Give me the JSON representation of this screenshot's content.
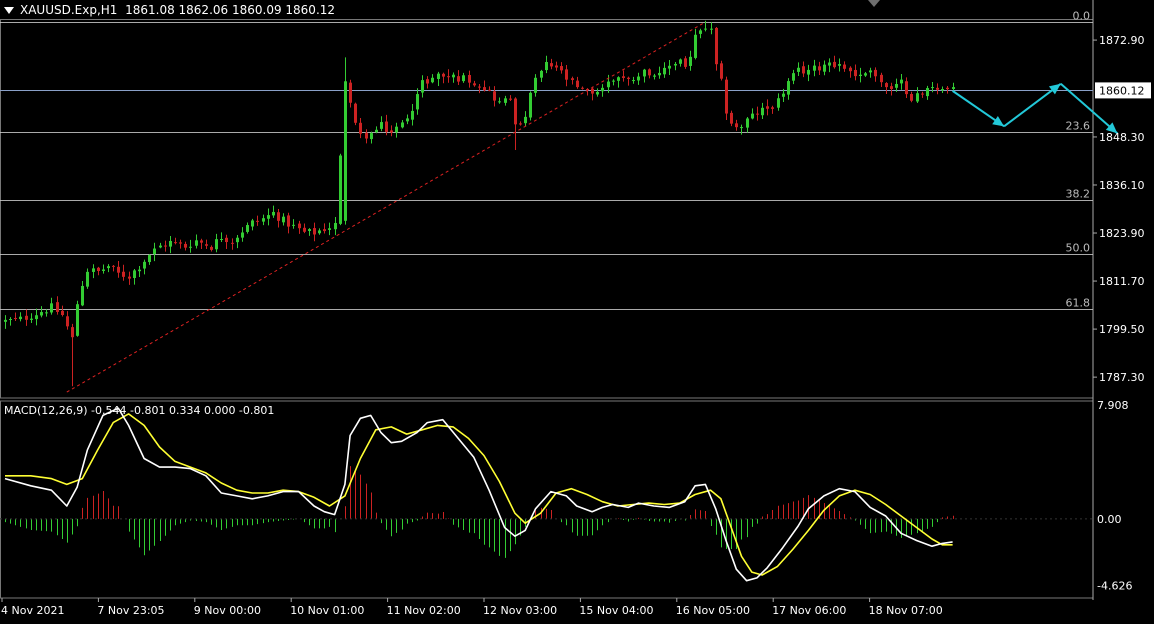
{
  "header": {
    "symbol": "XAUUSD.Exp,H1",
    "ohlc": "1861.08 1862.06 1860.09 1860.12"
  },
  "macd_header": {
    "label": "MACD(12,26,9)",
    "values": "-0.544 -0.801 0.334 0.000 -0.801"
  },
  "colors": {
    "background": "#000000",
    "bull": "#33cc33",
    "bear": "#cc2222",
    "grid": "#c8c8c8",
    "macd_line": "#ffffff",
    "signal_line": "#ffff33",
    "trend": "#dd2222",
    "forecast": "#22c8d8",
    "price_box": "#ffffff"
  },
  "chart_data": [
    {
      "type": "candlestick",
      "title": "XAUUSD.Exp,H1",
      "ylim": [
        1782.0,
        1878.0
      ],
      "price_ticks": [
        "1872.90",
        "1860.12",
        "1848.30",
        "1836.10",
        "1823.90",
        "1811.70",
        "1799.50",
        "1787.30"
      ],
      "time_ticks": [
        "4 Nov 2021",
        "7 Nov 23:05",
        "9 Nov 00:00",
        "10 Nov 01:00",
        "11 Nov 02:00",
        "12 Nov 03:00",
        "15 Nov 04:00",
        "16 Nov 05:00",
        "17 Nov 06:00",
        "18 Nov 07:00"
      ],
      "current_price": "1860.12",
      "fibonacci": [
        {
          "level": "0.0",
          "price": 1877.4
        },
        {
          "level": "23.6",
          "price": 1849.6
        },
        {
          "level": "38.2",
          "price": 1832.4
        },
        {
          "level": "50.0",
          "price": 1818.5
        },
        {
          "level": "61.8",
          "price": 1804.6
        }
      ],
      "close_path": [
        [
          0,
          1801.5
        ],
        [
          3,
          1802
        ],
        [
          6,
          1803.5
        ],
        [
          9,
          1805
        ],
        [
          11,
          1803
        ],
        [
          13,
          1797
        ],
        [
          14,
          1806
        ],
        [
          15,
          1811
        ],
        [
          16,
          1814.5
        ],
        [
          18,
          1814
        ],
        [
          20,
          1815.5
        ],
        [
          22,
          1813.5
        ],
        [
          24,
          1813
        ],
        [
          26,
          1815.5
        ],
        [
          28,
          1818.5
        ],
        [
          30,
          1820.5
        ],
        [
          32,
          1821.5
        ],
        [
          35,
          1820.5
        ],
        [
          37,
          1822
        ],
        [
          40,
          1820.5
        ],
        [
          42,
          1823
        ],
        [
          44,
          1822
        ],
        [
          46,
          1824.5
        ],
        [
          48,
          1826.5
        ],
        [
          50,
          1827.5
        ],
        [
          52,
          1829
        ],
        [
          54,
          1827
        ],
        [
          56,
          1825.5
        ],
        [
          58,
          1824
        ],
        [
          60,
          1824
        ],
        [
          62,
          1825
        ],
        [
          64,
          1826
        ],
        [
          65,
          1843
        ],
        [
          66,
          1863
        ],
        [
          67,
          1857
        ],
        [
          68,
          1851
        ],
        [
          69,
          1848.5
        ],
        [
          71,
          1849
        ],
        [
          73,
          1851
        ],
        [
          75,
          1849.5
        ],
        [
          77,
          1851.5
        ],
        [
          79,
          1856
        ],
        [
          81,
          1862
        ],
        [
          84,
          1864
        ],
        [
          87,
          1863.5
        ],
        [
          90,
          1863
        ],
        [
          93,
          1861
        ],
        [
          96,
          1857
        ],
        [
          98,
          1858
        ],
        [
          99,
          1852.5
        ],
        [
          100,
          1850.5
        ],
        [
          101,
          1854
        ],
        [
          103,
          1863
        ],
        [
          105,
          1866.5
        ],
        [
          107,
          1866
        ],
        [
          109,
          1863
        ],
        [
          111,
          1860.5
        ],
        [
          113,
          1859.5
        ],
        [
          115,
          1860
        ],
        [
          117,
          1862
        ],
        [
          119,
          1864
        ],
        [
          121,
          1862.5
        ],
        [
          123,
          1864.5
        ],
        [
          125,
          1865
        ],
        [
          127,
          1863.5
        ],
        [
          129,
          1866.5
        ],
        [
          131,
          1868
        ],
        [
          132,
          1866.5
        ],
        [
          133,
          1868.5
        ],
        [
          134,
          1873.5
        ],
        [
          135,
          1875
        ],
        [
          136,
          1876
        ],
        [
          137,
          1875
        ],
        [
          138,
          1866
        ],
        [
          139,
          1862
        ],
        [
          140,
          1855
        ],
        [
          141,
          1852
        ],
        [
          142,
          1850.5
        ],
        [
          143,
          1851
        ],
        [
          144,
          1852.5
        ],
        [
          146,
          1854.5
        ],
        [
          148,
          1855.5
        ],
        [
          150,
          1857.5
        ],
        [
          152,
          1862
        ],
        [
          154,
          1865
        ],
        [
          157,
          1865.5
        ],
        [
          160,
          1867.5
        ],
        [
          163,
          1866
        ],
        [
          166,
          1863.5
        ],
        [
          168,
          1866
        ],
        [
          170,
          1862
        ],
        [
          172,
          1860
        ],
        [
          174,
          1862
        ],
        [
          176,
          1858.5
        ],
        [
          178,
          1859
        ],
        [
          180,
          1861.5
        ],
        [
          182,
          1860.5
        ],
        [
          184,
          1860
        ]
      ],
      "trend_line": [
        [
          12,
          1783.5
        ],
        [
          136,
          1877.5
        ]
      ],
      "forecast_path": [
        [
          184,
          1860.0
        ],
        [
          194,
          1851.0
        ],
        [
          205,
          1861.8
        ],
        [
          216,
          1849.2
        ]
      ]
    },
    {
      "type": "macd",
      "title": "MACD(12,26,9)",
      "ylim": [
        -5.5,
        8.2
      ],
      "value_ticks": [
        "7.908",
        "0.00",
        "-4.626"
      ],
      "macd_path": [
        [
          0,
          2.8
        ],
        [
          5,
          2.3
        ],
        [
          9,
          2.0
        ],
        [
          12,
          0.9
        ],
        [
          14,
          2.2
        ],
        [
          16,
          4.8
        ],
        [
          19,
          7.2
        ],
        [
          22,
          7.7
        ],
        [
          24,
          6.5
        ],
        [
          27,
          4.2
        ],
        [
          30,
          3.6
        ],
        [
          33,
          3.6
        ],
        [
          36,
          3.5
        ],
        [
          39,
          3.0
        ],
        [
          42,
          1.8
        ],
        [
          45,
          1.6
        ],
        [
          48,
          1.4
        ],
        [
          51,
          1.6
        ],
        [
          54,
          1.9
        ],
        [
          57,
          1.9
        ],
        [
          60,
          0.9
        ],
        [
          62,
          0.5
        ],
        [
          64,
          0.3
        ],
        [
          66,
          2.4
        ],
        [
          67,
          5.8
        ],
        [
          69,
          7.0
        ],
        [
          71,
          7.2
        ],
        [
          73,
          6.0
        ],
        [
          75,
          5.3
        ],
        [
          77,
          5.4
        ],
        [
          80,
          6.0
        ],
        [
          82,
          6.7
        ],
        [
          85,
          6.9
        ],
        [
          88,
          5.6
        ],
        [
          91,
          4.3
        ],
        [
          94,
          2.0
        ],
        [
          97,
          -0.6
        ],
        [
          99,
          -1.2
        ],
        [
          101,
          -0.8
        ],
        [
          103,
          0.7
        ],
        [
          106,
          1.9
        ],
        [
          109,
          1.6
        ],
        [
          111,
          0.9
        ],
        [
          114,
          0.5
        ],
        [
          116,
          0.8
        ],
        [
          118,
          1.0
        ],
        [
          121,
          0.8
        ],
        [
          123,
          1.1
        ],
        [
          126,
          0.9
        ],
        [
          129,
          0.8
        ],
        [
          132,
          1.2
        ],
        [
          134,
          2.3
        ],
        [
          136,
          2.4
        ],
        [
          138,
          0.7
        ],
        [
          140,
          -1.5
        ],
        [
          142,
          -3.5
        ],
        [
          144,
          -4.3
        ],
        [
          146,
          -4.1
        ],
        [
          148,
          -3.4
        ],
        [
          151,
          -2.0
        ],
        [
          154,
          -0.5
        ],
        [
          156,
          0.7
        ],
        [
          159,
          1.6
        ],
        [
          162,
          2.1
        ],
        [
          165,
          1.9
        ],
        [
          168,
          0.8
        ],
        [
          171,
          0.2
        ],
        [
          174,
          -1.0
        ],
        [
          177,
          -1.5
        ],
        [
          180,
          -1.9
        ],
        [
          182,
          -1.7
        ],
        [
          184,
          -1.6
        ]
      ],
      "signal_path": [
        [
          0,
          3.0
        ],
        [
          5,
          3.0
        ],
        [
          9,
          2.8
        ],
        [
          12,
          2.4
        ],
        [
          15,
          2.8
        ],
        [
          18,
          4.8
        ],
        [
          21,
          6.7
        ],
        [
          24,
          7.3
        ],
        [
          27,
          6.5
        ],
        [
          30,
          5.0
        ],
        [
          33,
          4.0
        ],
        [
          36,
          3.6
        ],
        [
          39,
          3.2
        ],
        [
          42,
          2.5
        ],
        [
          45,
          2.0
        ],
        [
          48,
          1.8
        ],
        [
          51,
          1.8
        ],
        [
          54,
          2.0
        ],
        [
          57,
          1.9
        ],
        [
          60,
          1.5
        ],
        [
          63,
          0.9
        ],
        [
          66,
          1.6
        ],
        [
          69,
          4.2
        ],
        [
          72,
          6.2
        ],
        [
          75,
          6.4
        ],
        [
          78,
          5.9
        ],
        [
          81,
          6.2
        ],
        [
          84,
          6.5
        ],
        [
          87,
          6.4
        ],
        [
          90,
          5.6
        ],
        [
          93,
          4.4
        ],
        [
          96,
          2.6
        ],
        [
          99,
          0.4
        ],
        [
          101,
          -0.3
        ],
        [
          104,
          0.4
        ],
        [
          107,
          1.8
        ],
        [
          110,
          2.1
        ],
        [
          113,
          1.7
        ],
        [
          116,
          1.2
        ],
        [
          119,
          0.9
        ],
        [
          122,
          1.0
        ],
        [
          125,
          1.1
        ],
        [
          128,
          1.0
        ],
        [
          131,
          1.1
        ],
        [
          134,
          1.7
        ],
        [
          137,
          2.0
        ],
        [
          139,
          1.4
        ],
        [
          141,
          -0.6
        ],
        [
          143,
          -2.6
        ],
        [
          145,
          -3.7
        ],
        [
          147,
          -3.9
        ],
        [
          150,
          -3.3
        ],
        [
          153,
          -2.1
        ],
        [
          156,
          -0.8
        ],
        [
          159,
          0.6
        ],
        [
          162,
          1.6
        ],
        [
          165,
          2.0
        ],
        [
          168,
          1.7
        ],
        [
          171,
          1.0
        ],
        [
          174,
          0.2
        ],
        [
          177,
          -0.6
        ],
        [
          180,
          -1.4
        ],
        [
          182,
          -1.8
        ],
        [
          184,
          -1.8
        ]
      ]
    }
  ]
}
